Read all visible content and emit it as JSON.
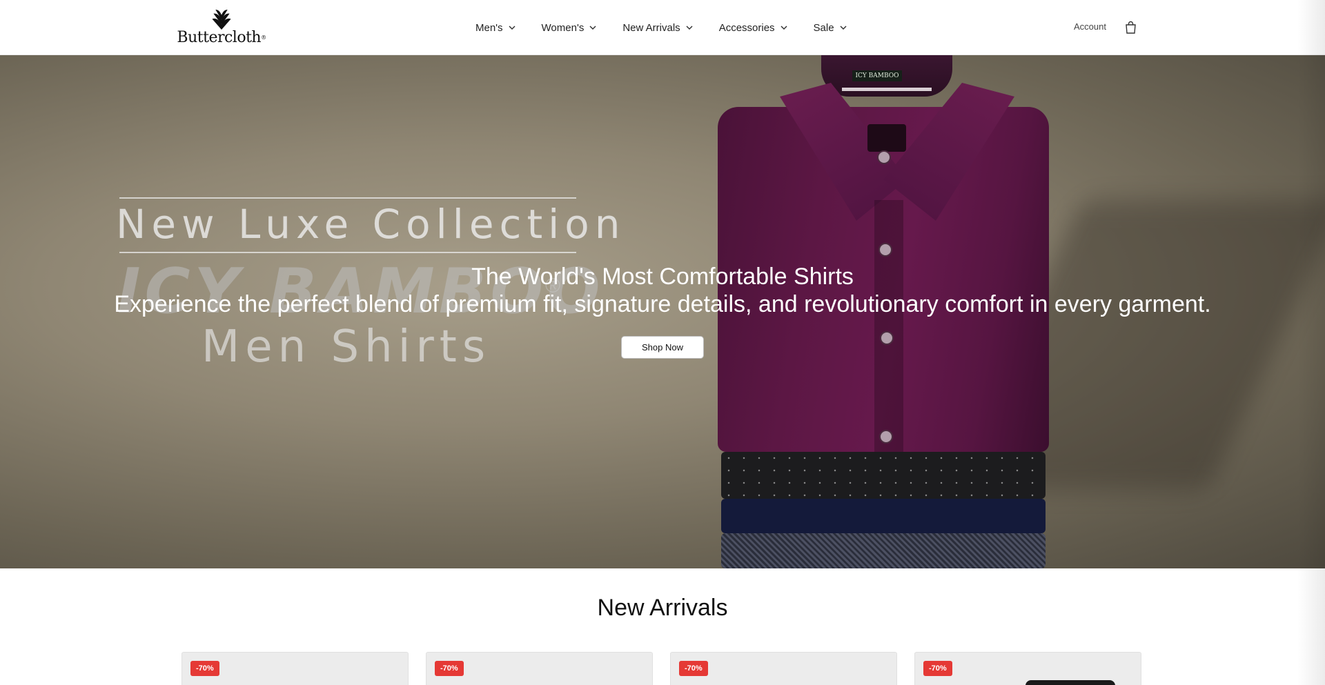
{
  "header": {
    "logo_text": "Buttercloth",
    "nav": [
      {
        "label": "Men's"
      },
      {
        "label": "Women's"
      },
      {
        "label": "New Arrivals"
      },
      {
        "label": "Accessories"
      },
      {
        "label": "Sale"
      }
    ],
    "account_label": "Account",
    "cart_icon": "shopping-bag-icon"
  },
  "hero": {
    "image_text": {
      "collection": "New Luxe Collection",
      "brand": "ICY BAMBOO",
      "registered": "®",
      "subline": "Men Shirts",
      "tag": "ICY BAMBOO"
    },
    "title": "The World's Most Comfortable Shirts",
    "subtitle": "Experience the perfect blend of premium fit, signature details, and revolutionary comfort in every garment.",
    "cta_label": "Shop Now"
  },
  "new_arrivals": {
    "title": "New Arrivals",
    "products": [
      {
        "badge": "-70%"
      },
      {
        "badge": "-70%"
      },
      {
        "badge": "-70%"
      },
      {
        "badge": "-70%"
      }
    ]
  },
  "colors": {
    "badge": "#e53935",
    "shirt": "#5c1744"
  }
}
